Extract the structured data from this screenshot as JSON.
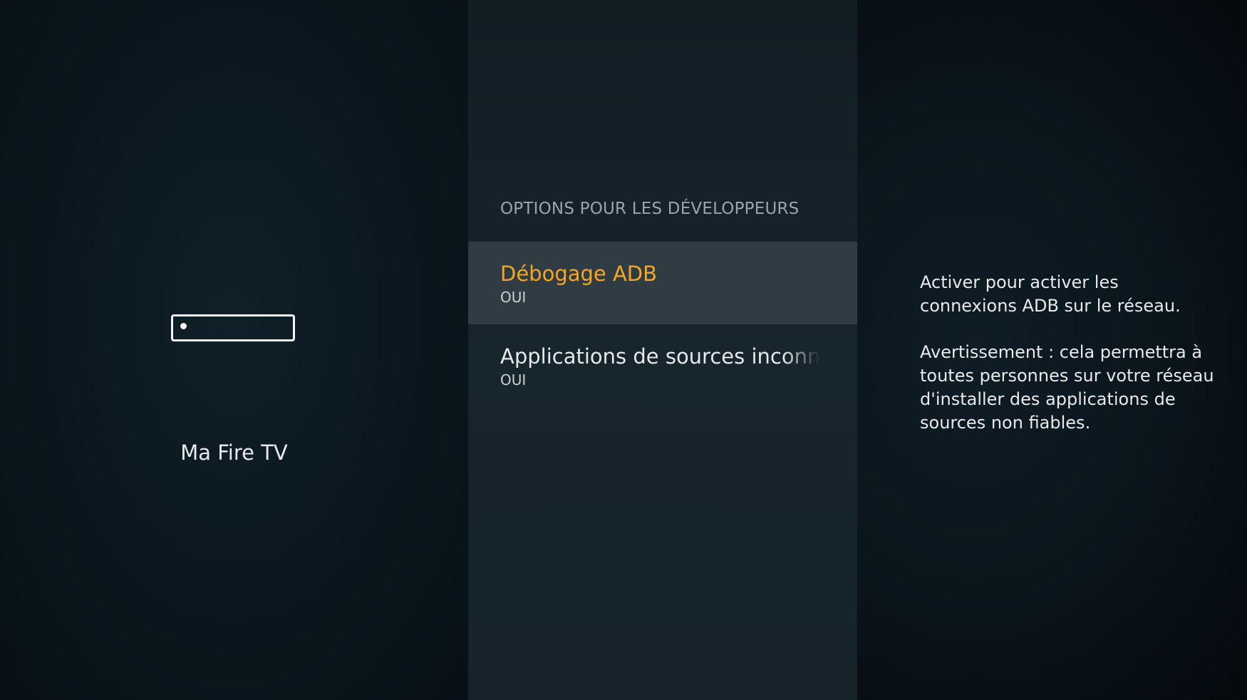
{
  "device": {
    "icon": "fire-tv-device-icon",
    "label": "Ma Fire TV"
  },
  "menu": {
    "title": "OPTIONS POUR LES DÉVELOPPEURS",
    "items": [
      {
        "label": "Débogage ADB",
        "value": "OUI",
        "selected": true
      },
      {
        "label": "Applications de sources inconnues",
        "value": "OUI",
        "selected": false
      }
    ]
  },
  "help": {
    "description": "Activer pour activer les connexions ADB sur le réseau.",
    "warning": "Avertissement : cela permettra à toutes personnes sur votre réseau d'installer des applications de sources non fiables."
  },
  "colors": {
    "accent": "#f5a623",
    "selected_background": "#303c44",
    "text": "#e6eaec"
  }
}
